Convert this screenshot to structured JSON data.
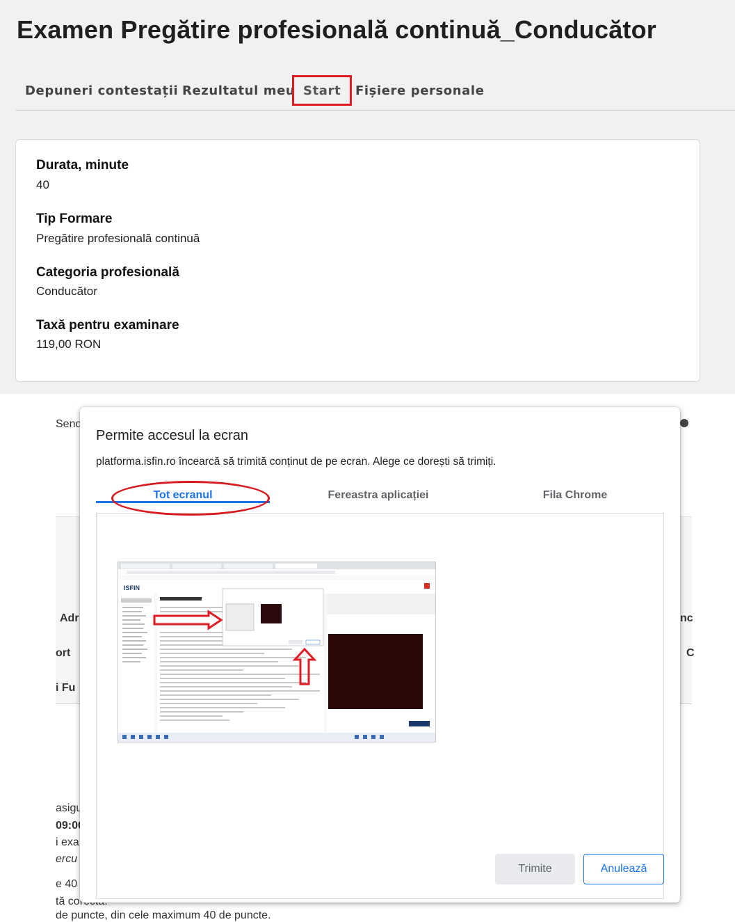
{
  "page": {
    "title": "Examen Pregătire profesională continuă_Conducător",
    "tabs": [
      "Depuneri contestații",
      "Rezultatul meu",
      "Start",
      "Fișiere personale"
    ]
  },
  "details": [
    {
      "label": "Durata, minute",
      "value": "40"
    },
    {
      "label": "Tip Formare",
      "value": "Pregătire profesională continuă"
    },
    {
      "label": "Categoria profesională",
      "value": "Conducător"
    },
    {
      "label": "Taxă pentru examinare",
      "value": "119,00 RON"
    }
  ],
  "background": {
    "send_fragment": "Send",
    "left_fragments": [
      "Adr",
      "ort",
      "i Fu",
      "asigu",
      "09:00",
      "i exa",
      "ercu",
      "e 40",
      "tă corectă."
    ],
    "right_fragments": [
      "nc",
      "C"
    ],
    "bottom_line": "de puncte, din cele maximum 40 de puncte."
  },
  "dialog": {
    "title": "Permite accesul la ecran",
    "description": "platforma.isfin.ro încearcă să trimită conținut de pe ecran. Alege ce dorești să trimiți.",
    "tabs": [
      "Tot ecranul",
      "Fereastra aplicației",
      "Fila Chrome"
    ],
    "active_tab": "Tot ecranul",
    "send_label": "Trimite",
    "cancel_label": "Anulează",
    "thumbnail_brand": "ISFIN"
  },
  "colors": {
    "annotation_red": "#e01b24",
    "accent_blue": "#1a73e8"
  }
}
